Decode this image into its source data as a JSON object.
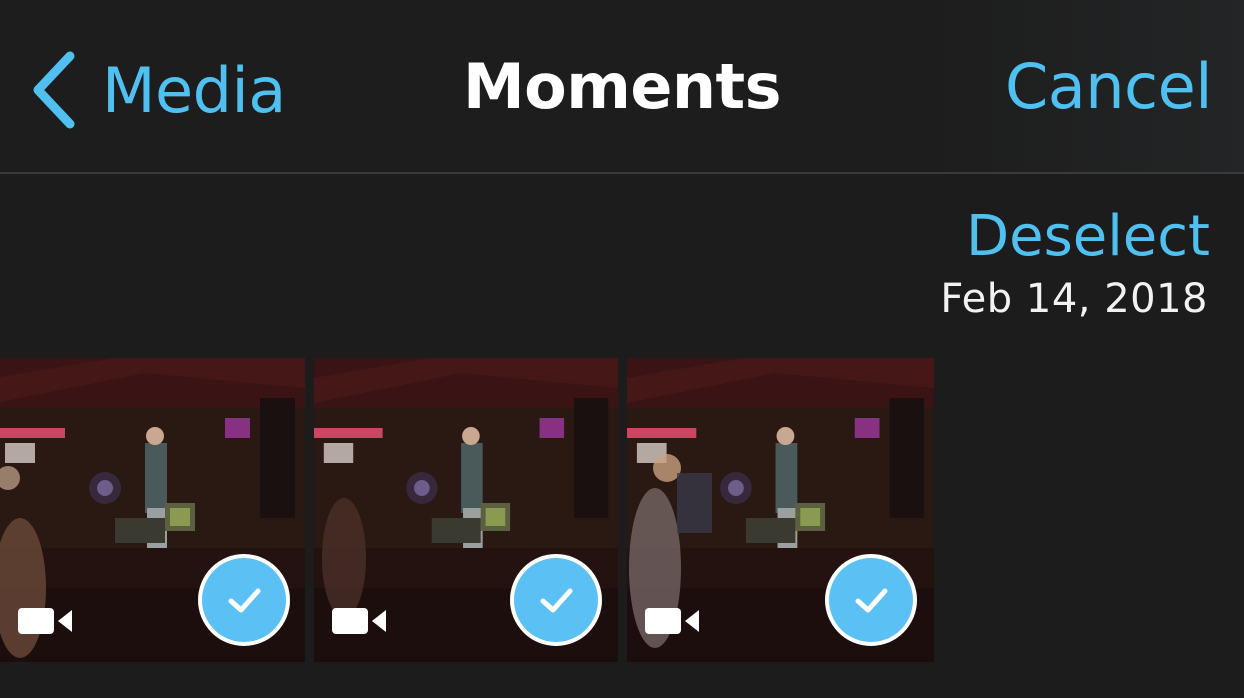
{
  "navbar": {
    "back_label": "Media",
    "title": "Moments",
    "cancel_label": "Cancel",
    "accent_color": "#4fc0f0"
  },
  "section": {
    "deselect_label": "Deselect",
    "date": "Feb 14, 2018"
  },
  "thumbnails": [
    {
      "type": "video",
      "selected": true,
      "icon": "video-camera-icon",
      "badge": "checkmark-icon"
    },
    {
      "type": "video",
      "selected": true,
      "icon": "video-camera-icon",
      "badge": "checkmark-icon"
    },
    {
      "type": "video",
      "selected": true,
      "icon": "video-camera-icon",
      "badge": "checkmark-icon"
    }
  ],
  "colors": {
    "background": "#1c1c1c",
    "accent": "#4fc0f0",
    "check_badge": "#5bc1f4",
    "title_text": "#ffffff"
  }
}
